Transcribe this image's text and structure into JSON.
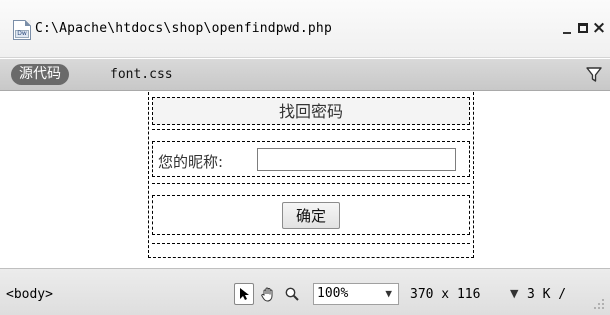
{
  "window": {
    "title": "C:\\Apache\\htdocs\\shop\\openfindpwd.php",
    "doc_icon_text": "Dw",
    "close_symbol": "×"
  },
  "related_files": {
    "source_label": "源代码",
    "file": "font.css"
  },
  "form": {
    "title": "找回密码",
    "nickname_label": "您的昵称:",
    "nickname_value": "",
    "submit_label": "确定"
  },
  "status": {
    "tag_selector": "<body>",
    "zoom": "100%",
    "window_size": "370 x 116",
    "download_info": "3 K /"
  },
  "icons": {
    "filter": "funnel-icon",
    "select_tool": "arrow-pointer-icon",
    "hand_tool": "hand-icon",
    "zoom_tool": "magnifier-icon",
    "dropdown": "chevron-down-icon",
    "resize_grip": "resize-grip-icon"
  }
}
